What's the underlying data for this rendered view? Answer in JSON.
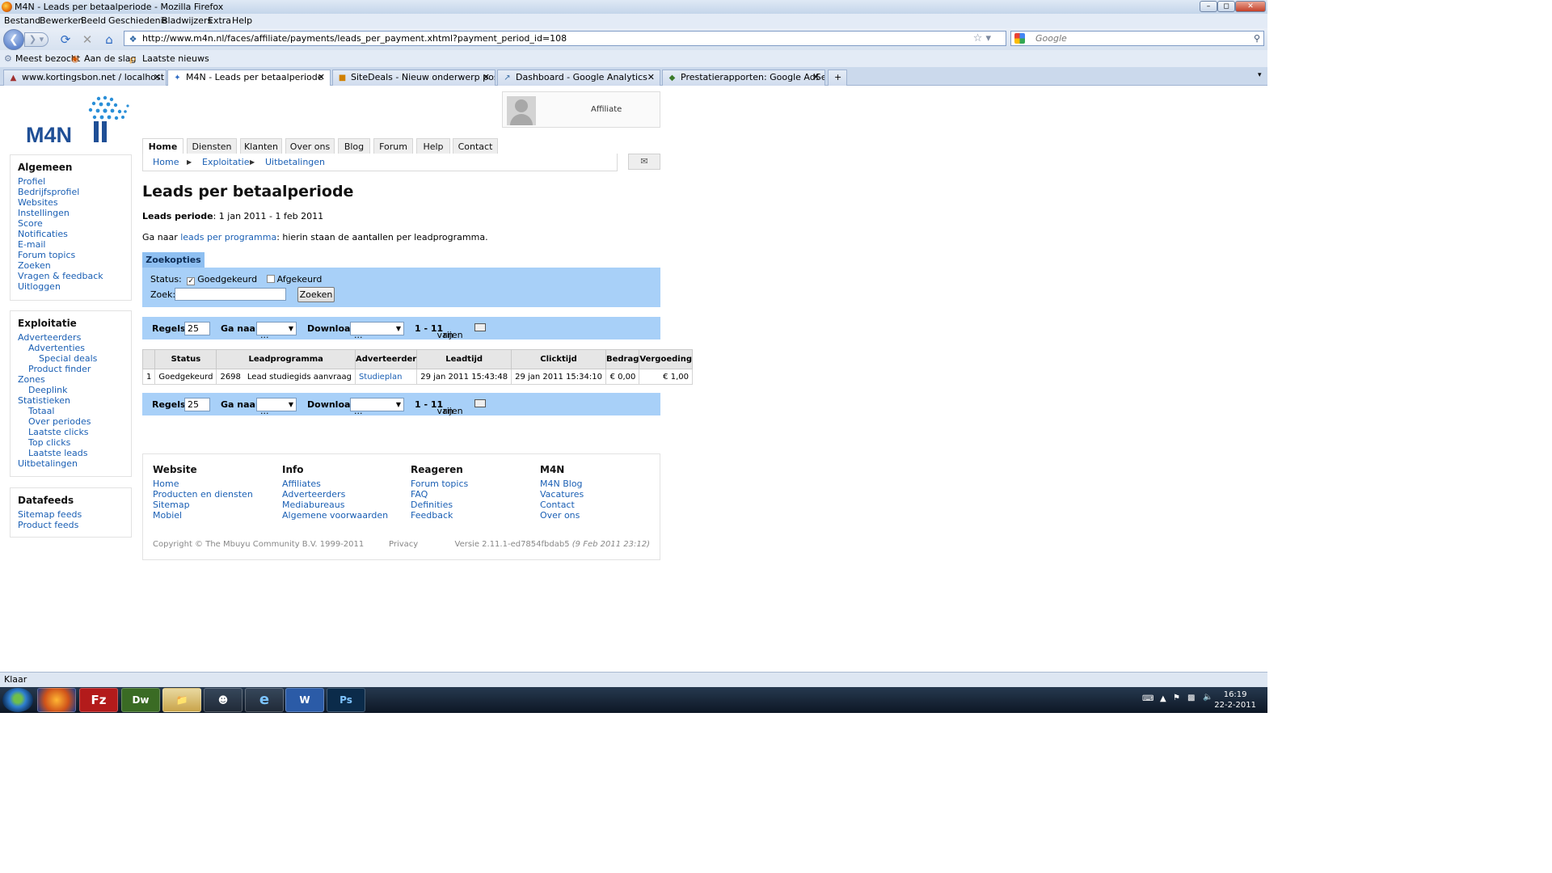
{
  "window": {
    "title": "M4N - Leads per betaalperiode - Mozilla Firefox"
  },
  "menu": [
    "Bestand",
    "Bewerken",
    "Beeld",
    "Geschiedenis",
    "Bladwijzers",
    "Extra",
    "Help"
  ],
  "url": "http://www.m4n.nl/faces/affiliate/payments/leads_per_payment.xhtml?payment_period_id=108",
  "search_placeholder": "Google",
  "bookmarks": [
    "Meest bezocht",
    "Aan de slag",
    "Laatste nieuws"
  ],
  "tabs": [
    "www.kortingsbon.net / localhost / ...",
    "M4N - Leads per betaalperiode",
    "SiteDeals - Nieuw onderwerp posten",
    "Dashboard - Google Analytics",
    "Prestatierapporten: Google AdSense"
  ],
  "logo_text": "M4N",
  "user": {
    "role": "Affiliate"
  },
  "nav": [
    "Home",
    "Diensten",
    "Klanten",
    "Over ons",
    "Blog",
    "Forum",
    "Help",
    "Contact"
  ],
  "breadcrumb": [
    "Home",
    "Exploitatie",
    "Uitbetalingen"
  ],
  "sidebar": {
    "algemeen": {
      "title": "Algemeen",
      "items": [
        "Profiel",
        "Bedrijfsprofiel",
        "Websites",
        "Instellingen",
        "Score",
        "Notificaties",
        "E-mail",
        "Forum topics",
        "Zoeken",
        "Vragen & feedback",
        "Uitloggen"
      ]
    },
    "exploitatie": {
      "title": "Exploitatie",
      "items": [
        {
          "label": "Adverteerders",
          "level": 0
        },
        {
          "label": "Advertenties",
          "level": 1
        },
        {
          "label": "Special deals",
          "level": 2
        },
        {
          "label": "Product finder",
          "level": 1
        },
        {
          "label": "Zones",
          "level": 0
        },
        {
          "label": "Deeplink",
          "level": 1
        },
        {
          "label": "Statistieken",
          "level": 0
        },
        {
          "label": "Totaal",
          "level": 1
        },
        {
          "label": "Over periodes",
          "level": 1
        },
        {
          "label": "Laatste clicks",
          "level": 1
        },
        {
          "label": "Top clicks",
          "level": 1
        },
        {
          "label": "Laatste leads",
          "level": 1
        },
        {
          "label": "Uitbetalingen",
          "level": 0
        }
      ]
    },
    "datafeeds": {
      "title": "Datafeeds",
      "items": [
        "Sitemap feeds",
        "Product feeds"
      ]
    }
  },
  "main": {
    "title": "Leads per betaalperiode",
    "period_label": "Leads periode",
    "period_value": ": 1 jan 2011 - 1 feb 2011",
    "goto_prefix": "Ga naar ",
    "goto_link": "leads per programma",
    "goto_suffix": ": hierin staan de aantallen per leadprogramma."
  },
  "search": {
    "tab": "Zoekopties",
    "status_label": "Status:",
    "opt1": "Goedgekeurd",
    "opt1_checked": true,
    "opt2": "Afgekeurd",
    "opt2_checked": false,
    "zoek_label": "Zoek:",
    "zoek_value": "",
    "button": "Zoeken"
  },
  "pager": {
    "regels_label": "Regels:",
    "regels_value": "25",
    "ganaar_label": "Ga naar:",
    "ganaar_value": "...",
    "download_label": "Download:",
    "download_value": "...",
    "range": "1 - 1",
    "van": " van ",
    "total": "1",
    "rijen": " rijen"
  },
  "table": {
    "headers": [
      "",
      "Status",
      "Leadprogramma",
      "Adverteerder",
      "Leadtijd",
      "Clicktijd",
      "Bedrag",
      "Vergoeding"
    ],
    "rows": [
      [
        "1",
        "Goedgekeurd",
        "2698",
        "Lead studiegids aanvraag",
        "Studieplan",
        "29 jan 2011 15:43:48",
        "29 jan 2011 15:34:10",
        "€ 0,00",
        "€ 1,00"
      ]
    ]
  },
  "footer": {
    "cols": [
      {
        "title": "Website",
        "items": [
          "Home",
          "Producten en diensten",
          "Sitemap",
          "Mobiel"
        ]
      },
      {
        "title": "Info",
        "items": [
          "Affiliates",
          "Adverteerders",
          "Mediabureaus",
          "Algemene voorwaarden"
        ]
      },
      {
        "title": "Reageren",
        "items": [
          "Forum topics",
          "FAQ",
          "Definities",
          "Feedback"
        ]
      },
      {
        "title": "M4N",
        "items": [
          "M4N Blog",
          "Vacatures",
          "Contact",
          "Over ons"
        ]
      }
    ],
    "copyright": "Copyright © The Mbuyu Community B.V. 1999-2011",
    "privacy": "Privacy",
    "version": "Versie 2.11.1-ed7854fbdab5",
    "version_date": "(9 Feb 2011 23:12)"
  },
  "status_text": "Klaar",
  "taskbar": {
    "time": "16:19",
    "date": "22-2-2011"
  }
}
